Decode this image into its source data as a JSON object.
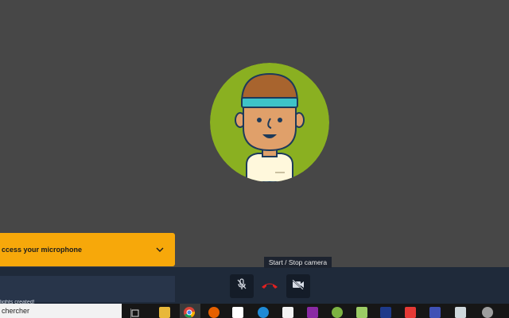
{
  "call": {
    "participant_avatar": "user-avatar"
  },
  "warning": {
    "text": "ccess your microphone"
  },
  "tooltip": {
    "text": "Start / Stop camera"
  },
  "notice": {
    "text": "lights created!"
  },
  "controls": {
    "mic_icon": "mic-muted-icon",
    "hangup_icon": "hangup-icon",
    "camera_icon": "camera-off-icon",
    "mic_state": "muted",
    "camera_state": "off"
  },
  "taskbar": {
    "search_text": "chercher",
    "apps": [
      "task-view-icon",
      "file-explorer-icon",
      "chrome-icon",
      "firefox-icon",
      "mail-icon",
      "edge-icon",
      "store-icon",
      "onenote-icon",
      "android-icon",
      "notepad-icon",
      "powershell-icon",
      "media-app-icon",
      "network-app-icon",
      "remote-desktop-icon",
      "people-icon"
    ]
  },
  "colors": {
    "background": "#474747",
    "avatar_bg": "#8ab021",
    "warning": "#f7a80a",
    "toolbar": "#1f2a3a",
    "hangup": "#e02020"
  }
}
